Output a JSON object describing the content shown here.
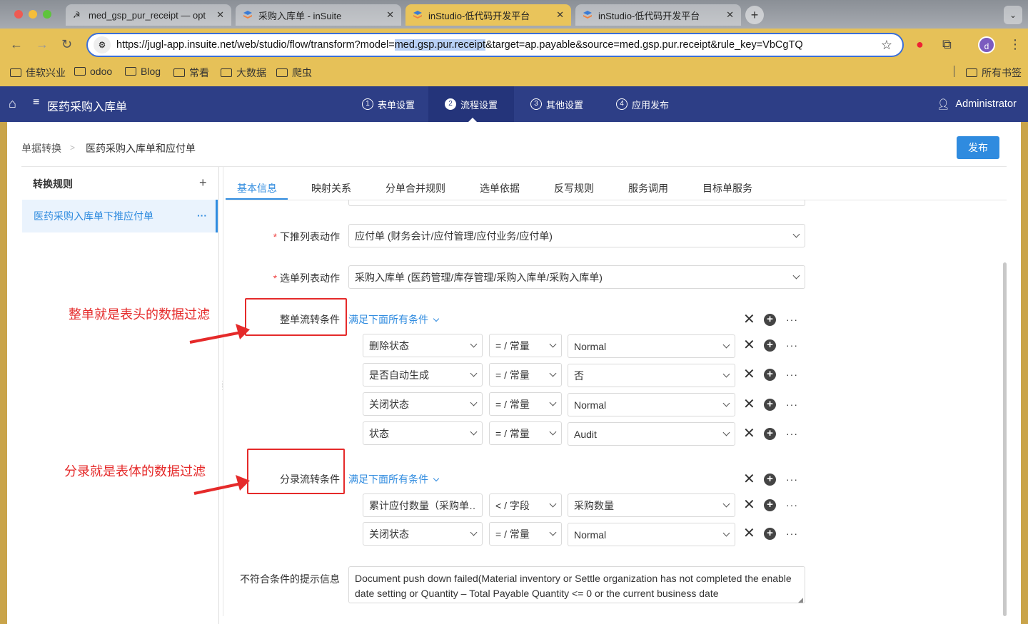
{
  "browser": {
    "tabs": [
      {
        "label": "med_gsp_pur_receipt — opt"
      },
      {
        "label": "采购入库单 - inSuite"
      },
      {
        "label": "inStudio-低代码开发平台"
      },
      {
        "label": "inStudio-低代码开发平台"
      }
    ],
    "url_prefix": "https://jugl-app.insuite.net/web/studio/flow/transform?model=",
    "url_highlight": "med.gsp.pur.receipt",
    "url_suffix": "&target=ap.payable&source=med.gsp.pur.receipt&rule_key=VbCgTQ",
    "avatar_letter": "d",
    "bookmarks": [
      "佳软兴业",
      "odoo",
      "Blog",
      "常看",
      "大数据",
      "爬虫"
    ],
    "all_bookmarks": "所有书签"
  },
  "app": {
    "title": "医药采购入库单",
    "steps": [
      {
        "num": "1",
        "label": "表单设置"
      },
      {
        "num": "2",
        "label": "流程设置"
      },
      {
        "num": "3",
        "label": "其他设置"
      },
      {
        "num": "4",
        "label": "应用发布"
      }
    ],
    "user": "Administrator"
  },
  "breadcrumb": {
    "parent": "单据转换",
    "sep": ">",
    "current": "医药采购入库单和应付单"
  },
  "publish_label": "发布",
  "sidebar": {
    "title": "转换规则",
    "add": "+",
    "items": [
      {
        "label": "医药采购入库单下推应付单",
        "more": "···"
      }
    ]
  },
  "tabs": [
    "基本信息",
    "映射关系",
    "分单合并规则",
    "选单依据",
    "反写规则",
    "服务调用",
    "目标单服务"
  ],
  "form": {
    "push_action_label": "下推列表动作",
    "push_action_value": "应付单 (财务会计/应付管理/应付业务/应付单)",
    "select_action_label": "选单列表动作",
    "select_action_value": "采购入库单 (医药管理/库存管理/采购入库单/采购入库单)",
    "required_mark": "*",
    "header_cond_label": "整单流转条件",
    "line_cond_label": "分录流转条件",
    "match_all": "满足下面所有条件",
    "header_conditions": [
      {
        "field": "删除状态",
        "op": "= / 常量",
        "value": "Normal"
      },
      {
        "field": "是否自动生成",
        "op": "= / 常量",
        "value": "否"
      },
      {
        "field": "关闭状态",
        "op": "= / 常量",
        "value": "Normal"
      },
      {
        "field": "状态",
        "op": "= / 常量",
        "value": "Audit"
      }
    ],
    "line_conditions": [
      {
        "field": "累计应付数量（采购单…",
        "op": "< / 字段",
        "value": "采购数量"
      },
      {
        "field": "关闭状态",
        "op": "= / 常量",
        "value": "Normal"
      }
    ],
    "hint_label": "不符合条件的提示信息",
    "hint_value": "Document push down failed(Material inventory or Settle organization has not completed the enable date setting or Quantity – Total Payable Quantity <= 0 or the current business date"
  },
  "annotations": {
    "header": "整单就是表头的数据过滤",
    "line": "分录就是表体的数据过滤"
  },
  "colors": {
    "accent": "#2f8bdf",
    "header_bg": "#2d3e86",
    "annotation": "#e52a2a",
    "browser_bar": "#e6c158"
  }
}
